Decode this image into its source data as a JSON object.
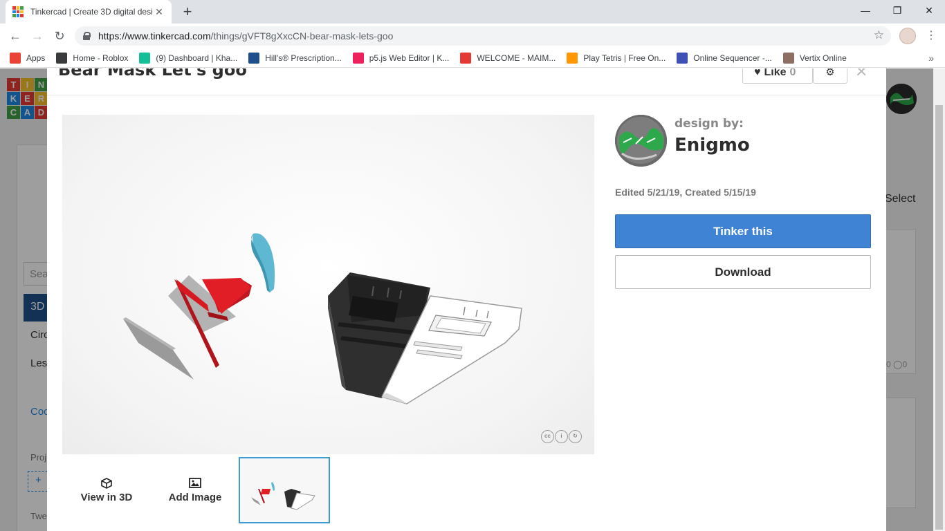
{
  "browser": {
    "tab_title": "Tinkercad | Create 3D digital desi",
    "tab_close": "✕",
    "new_tab": "+",
    "url_host": "https://www.tinkercad.com",
    "url_path": "/things/gVFT8gXxcCN-bear-mask-lets-goo",
    "window_controls": [
      "—",
      "❐",
      "✕"
    ],
    "bookmarks": [
      {
        "label": "Apps",
        "icon": "apps-grid-icon",
        "color": "#ea4335"
      },
      {
        "label": "Home - Roblox",
        "icon": "roblox-icon",
        "color": "#393b3d"
      },
      {
        "label": "(9) Dashboard | Kha...",
        "icon": "khan-academy-icon",
        "color": "#14bf96"
      },
      {
        "label": "Hill's® Prescription...",
        "icon": "hills-icon",
        "color": "#1e4f8a"
      },
      {
        "label": "p5.js Web Editor | K...",
        "icon": "p5js-icon",
        "color": "#ed225d"
      },
      {
        "label": "WELCOME - MAIM...",
        "icon": "maim-icon",
        "color": "#e53935"
      },
      {
        "label": "Play Tetris | Free On...",
        "icon": "tetris-icon",
        "color": "#ff9800"
      },
      {
        "label": "Online Sequencer -...",
        "icon": "sequencer-icon",
        "color": "#3f51b5"
      },
      {
        "label": "Vertix Online",
        "icon": "vertix-icon",
        "color": "#8d6e63"
      }
    ],
    "more_bookmarks": "»"
  },
  "background_page": {
    "logo_letters": [
      "T",
      "I",
      "N",
      "K",
      "E",
      "R",
      "C",
      "A",
      "D"
    ],
    "search_fragment": "Sea",
    "nav_3d": "3D",
    "item_circ": "Circ",
    "item_less": "Less",
    "item_coo": "Coo",
    "item_proj": "Proj",
    "item_add": "+",
    "item_twe": "Twe",
    "select_label": "Select",
    "card_stats": "0 ◯0"
  },
  "modal": {
    "title": "Bear Mask Let's goo",
    "like_label": "Like",
    "like_count": "0",
    "gear_icon": "⚙",
    "close_icon": "✕",
    "design_by_label": "design by:",
    "designer_name": "Enigmo",
    "dates": "Edited 5/21/19, Created 5/15/19",
    "tinker_button": "Tinker this",
    "download_button": "Download",
    "view_3d_label": "View in 3D",
    "add_image_label": "Add Image",
    "license_badges": [
      "cc",
      "i",
      "↻"
    ]
  },
  "colors": {
    "accent_blue": "#3f83d4",
    "thumbnail_border": "#3e9bd2",
    "model_red": "#e11d26",
    "model_cyan": "#5fb8d2",
    "model_black": "#262626"
  }
}
